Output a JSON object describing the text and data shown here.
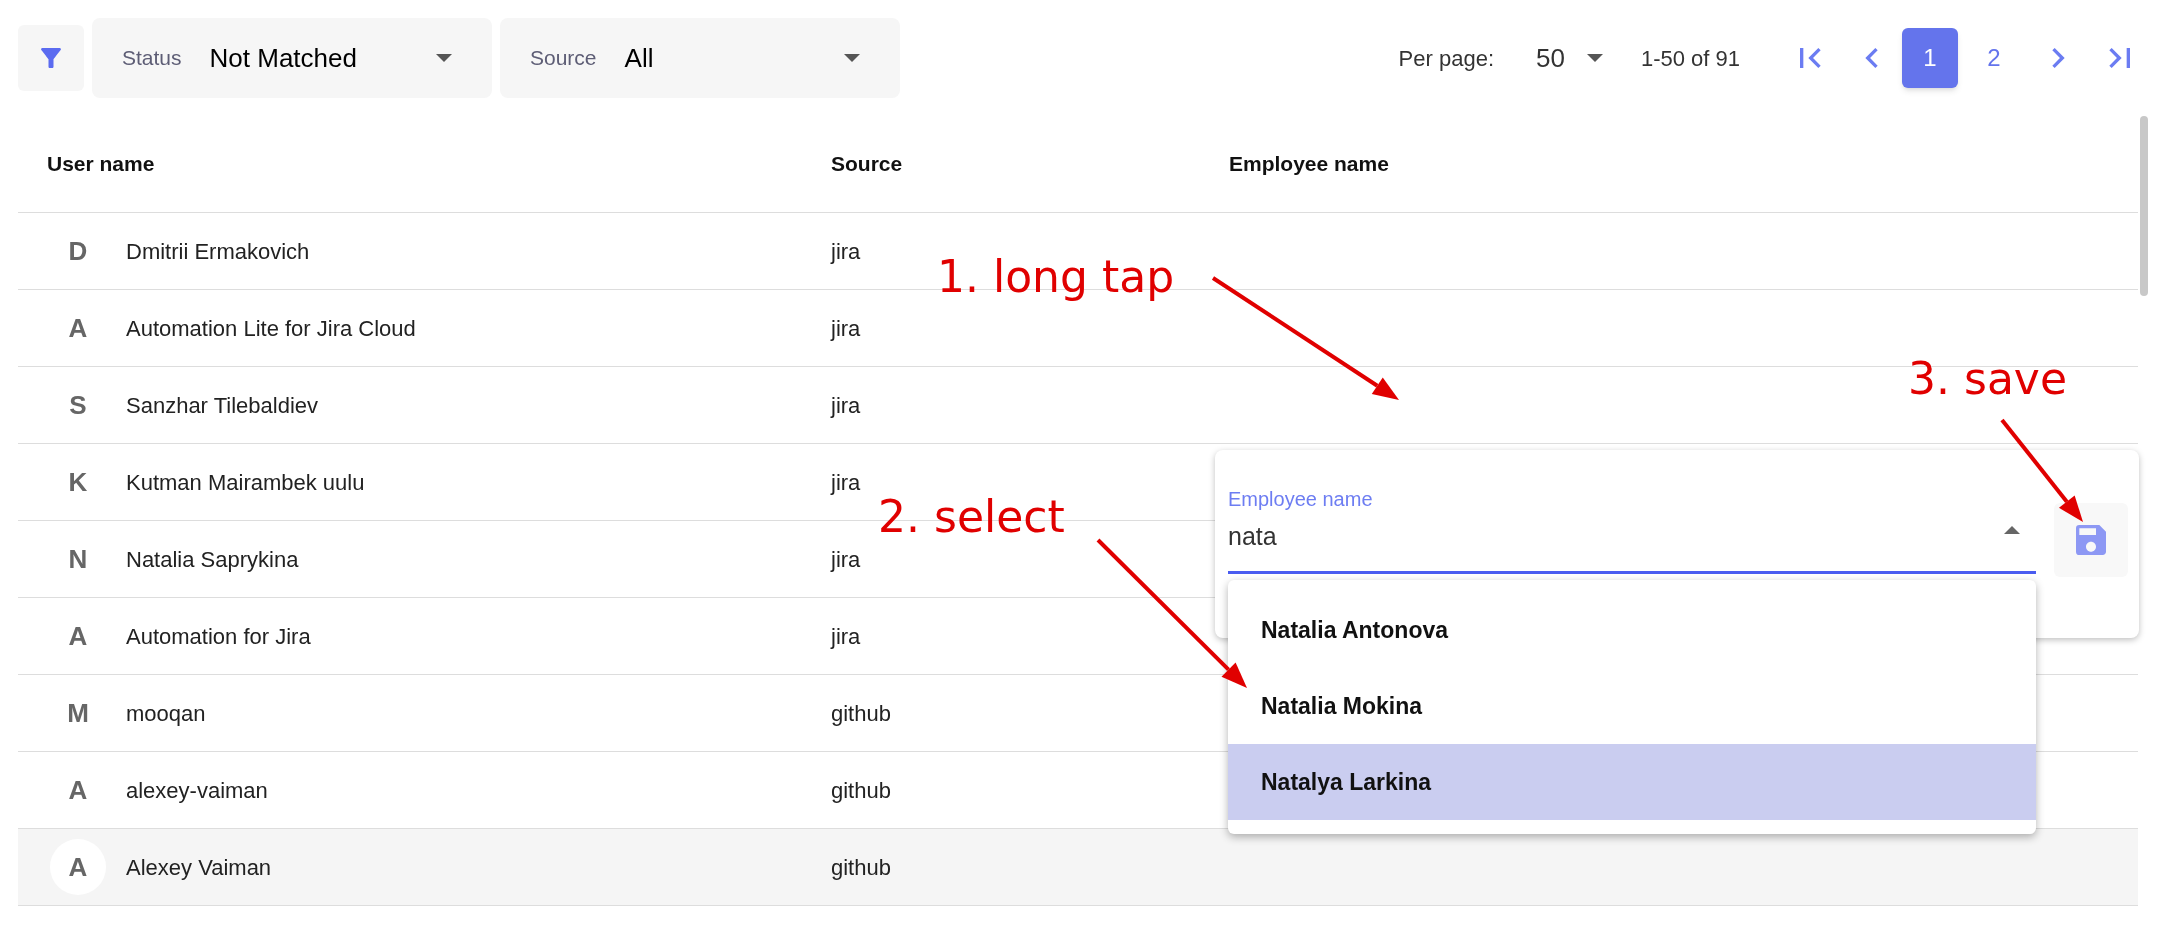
{
  "filters": {
    "status": {
      "label": "Status",
      "value": "Not Matched"
    },
    "source": {
      "label": "Source",
      "value": "All"
    }
  },
  "pagination": {
    "per_page_label": "Per page:",
    "per_page": "50",
    "range": "1-50 of 91",
    "pages": [
      {
        "label": "1",
        "selected": true
      },
      {
        "label": "2",
        "selected": false
      }
    ]
  },
  "table": {
    "columns": [
      "User name",
      "Source",
      "Employee name"
    ],
    "rows": [
      {
        "initial": "D",
        "user_name": "Dmitrii Ermakovich",
        "source": "jira",
        "hovered": false
      },
      {
        "initial": "A",
        "user_name": "Automation Lite for Jira Cloud",
        "source": "jira",
        "hovered": false
      },
      {
        "initial": "S",
        "user_name": "Sanzhar Tilebaldiev",
        "source": "jira",
        "hovered": false
      },
      {
        "initial": "K",
        "user_name": "Kutman Mairambek uulu",
        "source": "jira",
        "hovered": false
      },
      {
        "initial": "N",
        "user_name": "Natalia Saprykina",
        "source": "jira",
        "hovered": false
      },
      {
        "initial": "A",
        "user_name": "Automation for Jira",
        "source": "jira",
        "hovered": false
      },
      {
        "initial": "M",
        "user_name": "mooqan",
        "source": "github",
        "hovered": false
      },
      {
        "initial": "A",
        "user_name": "alexey-vaiman",
        "source": "github",
        "hovered": false
      },
      {
        "initial": "A",
        "user_name": "Alexey Vaiman",
        "source": "github",
        "hovered": true
      }
    ]
  },
  "editor": {
    "label": "Employee name",
    "value": "nata",
    "options": [
      {
        "label": "Natalia Antonova",
        "selected": false
      },
      {
        "label": "Natalia Mokina",
        "selected": false
      },
      {
        "label": "Natalya Larkina",
        "selected": true
      }
    ]
  },
  "annotations": [
    {
      "text": "1. long tap"
    },
    {
      "text": "2. select"
    },
    {
      "text": "3. save"
    }
  ]
}
